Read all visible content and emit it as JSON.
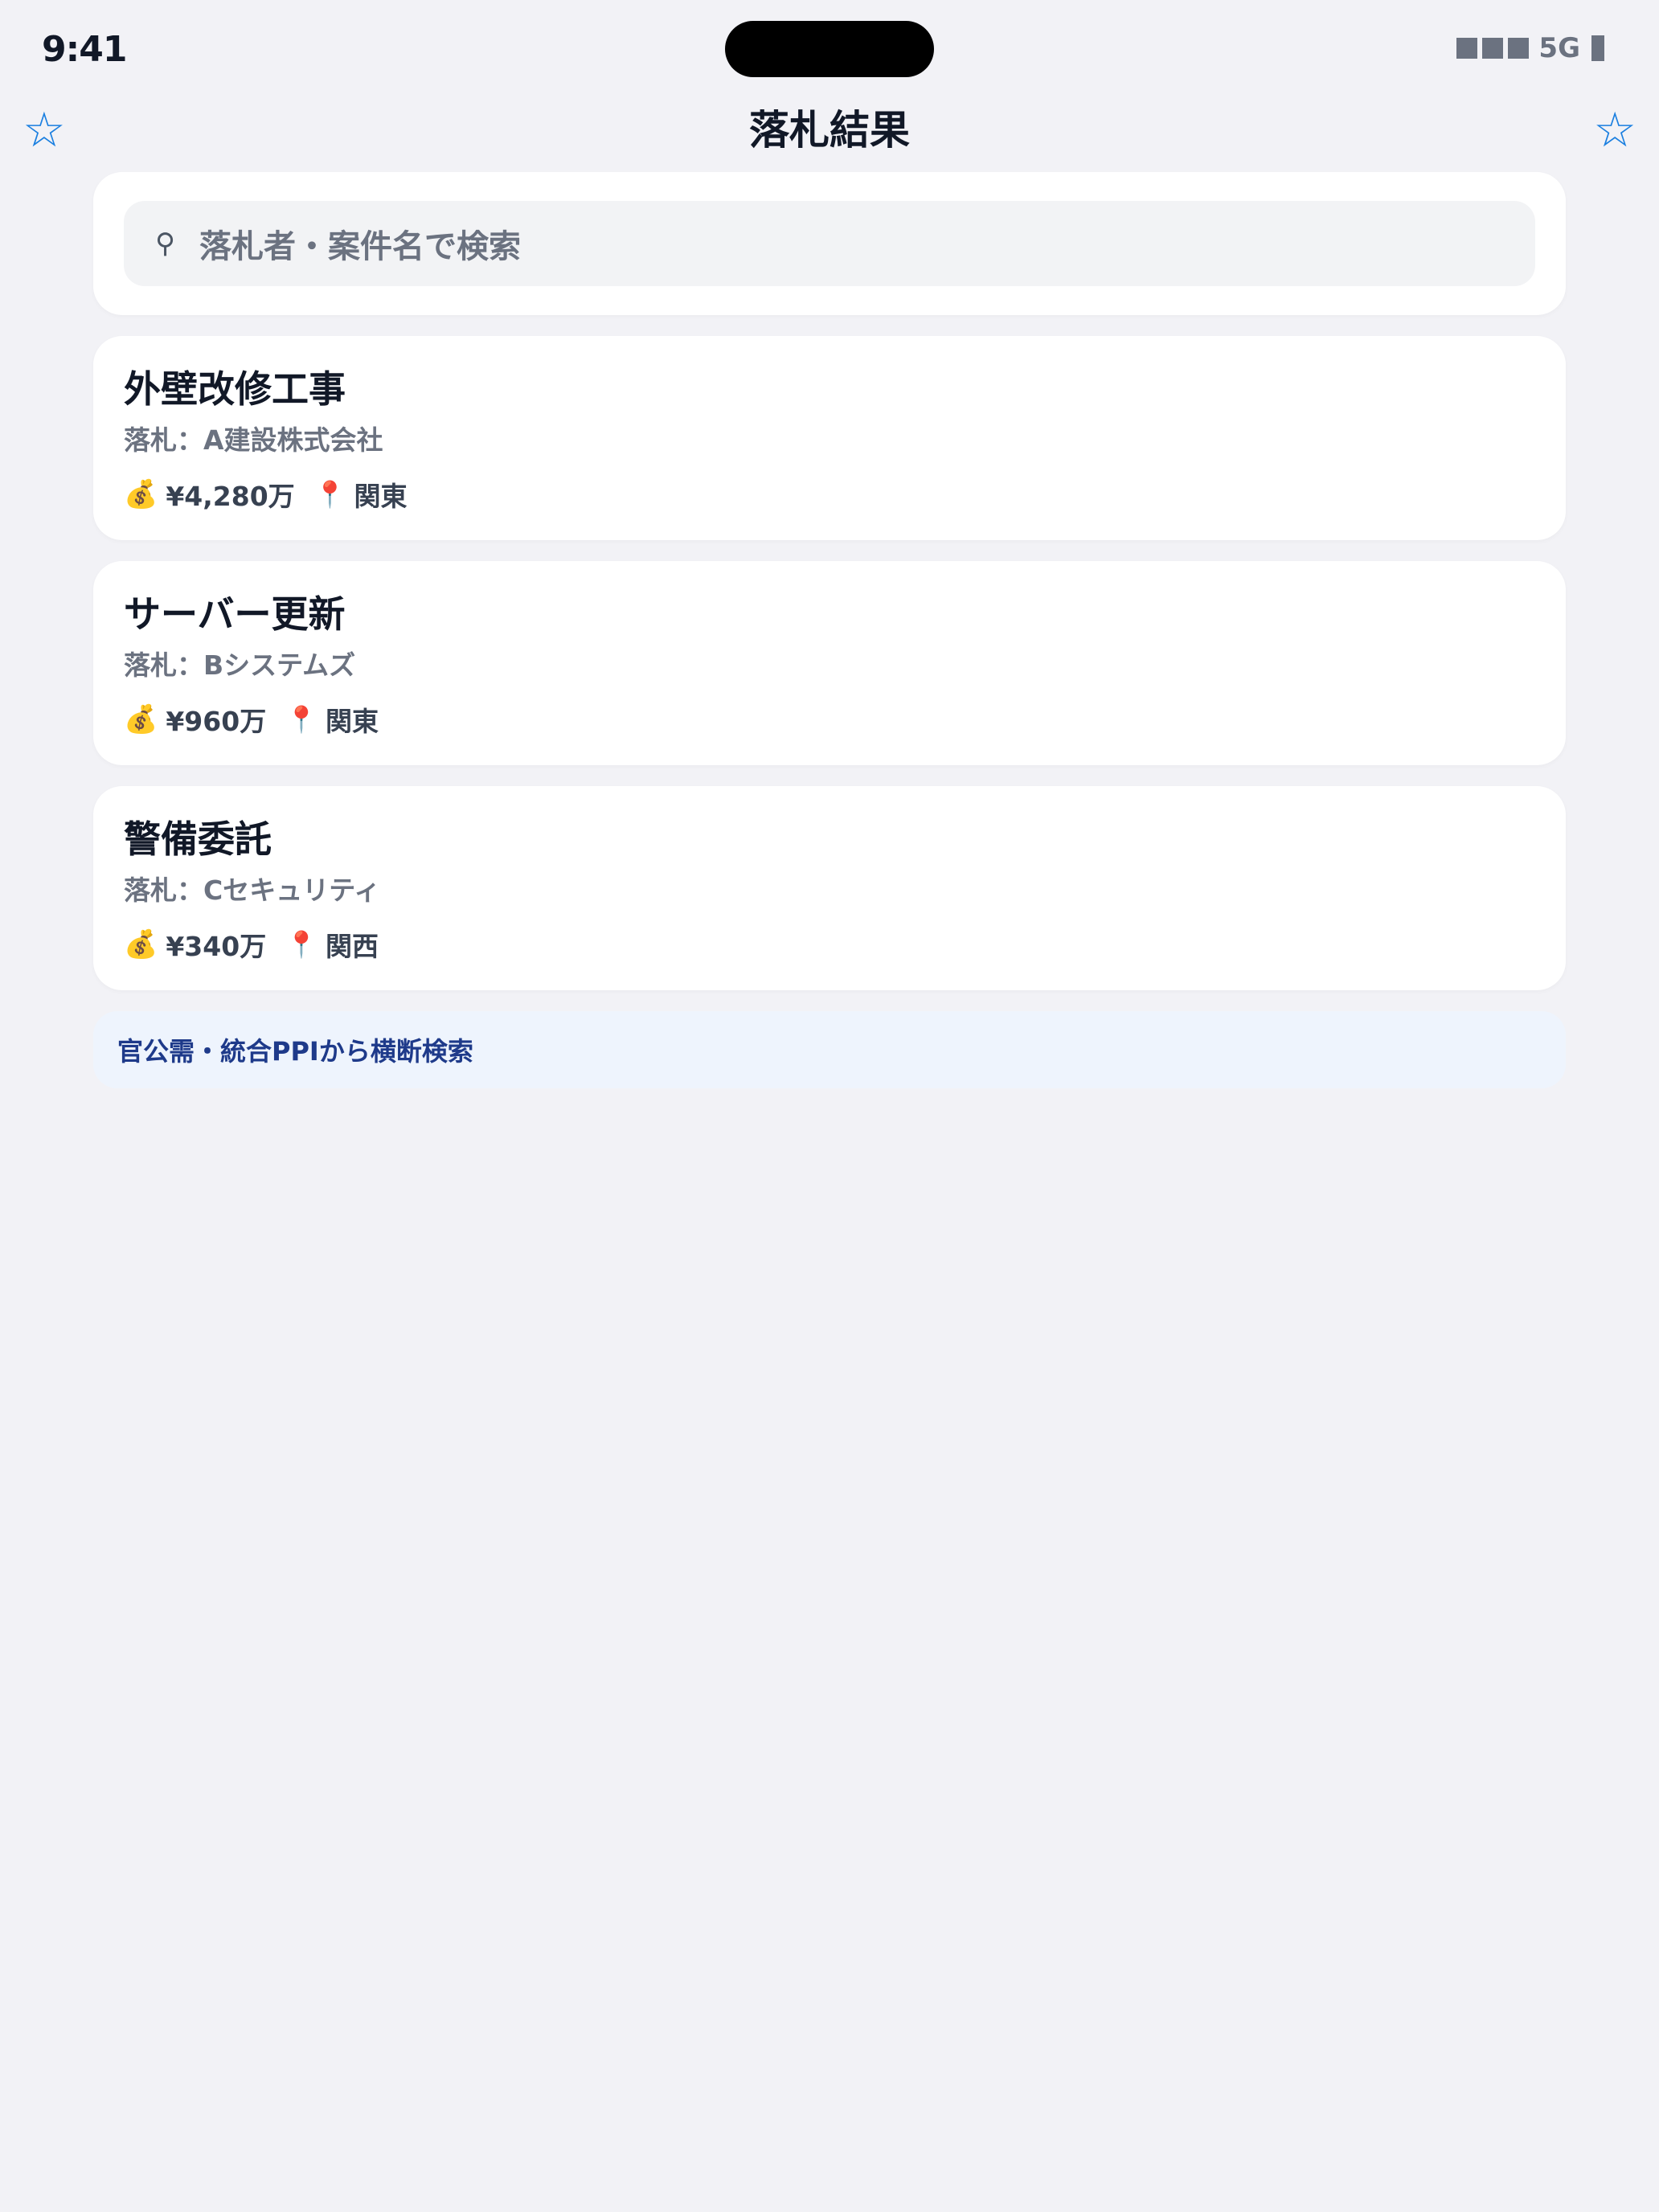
{
  "status_bar": {
    "time": "9:41",
    "network": "5G",
    "signal_icon": "signal-bars-icon",
    "battery_icon": "battery-icon"
  },
  "nav": {
    "title": "落札結果",
    "left_icon": "star-icon",
    "right_icon": "star-icon",
    "star_glyph": "☆",
    "accent_color": "#1a7fe0"
  },
  "search": {
    "icon": "search-icon",
    "glyph": "⚲",
    "placeholder": "落札者・案件名で検索"
  },
  "results": [
    {
      "title": "外壁改修工事",
      "winner": "落札：A建設株式会社",
      "amount": "¥4,280万",
      "region": "関東"
    },
    {
      "title": "サーバー更新",
      "winner": "落札：Bシステムズ",
      "amount": "¥960万",
      "region": "関東"
    },
    {
      "title": "警備委託",
      "winner": "落札：Cセキュリティ",
      "amount": "¥340万",
      "region": "関西"
    }
  ],
  "icons": {
    "money": "💰",
    "pin": "📍"
  },
  "footer": {
    "source_text": "官公需・統合PPIから横断検索"
  }
}
